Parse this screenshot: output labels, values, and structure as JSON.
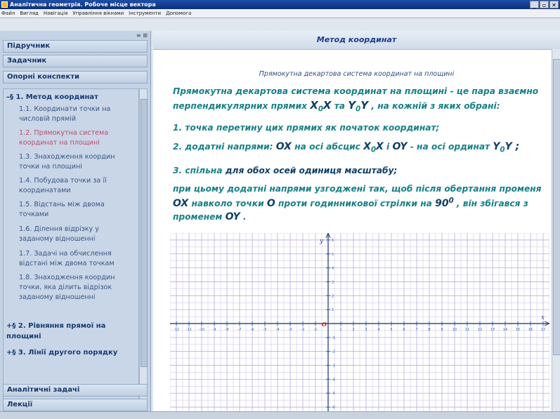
{
  "window": {
    "title": "Аналітична геометрія. Робоче місце вектора",
    "buttons": [
      "_",
      "▫",
      "✕"
    ]
  },
  "menu": [
    "Файл",
    "Вигляд",
    "Навігація",
    "Управління вікнами",
    "Інструменти",
    "Допомога"
  ],
  "sidebar": {
    "pin": "≡ ⊠",
    "tabs": [
      "Підручник",
      "Задачник",
      "Опорні конспекти"
    ],
    "bottom_tabs": [
      "Аналітичні задачі",
      "Лекції"
    ],
    "tree": {
      "sections": [
        {
          "marker": "–",
          "label": "§ 1. Метод координат",
          "items": [
            {
              "lines": [
                "1.1. Координати точки на",
                "числовій прямій"
              ]
            },
            {
              "lines": [
                "1.2. Прямокутна система",
                "координат на площині"
              ],
              "active": true
            },
            {
              "lines": [
                "1.3. Знаходження координ",
                "точки на площині"
              ]
            },
            {
              "lines": [
                "1.4. Побудова точки за її",
                "координатами"
              ]
            },
            {
              "lines": [
                "1.5. Відстань між двома",
                "точками"
              ]
            },
            {
              "lines": [
                "1.6. Ділення відрізку у",
                "заданому відношенні"
              ]
            },
            {
              "lines": [
                "1.7. Задачі на обчислення",
                "відстані між двома точкам"
              ]
            },
            {
              "lines": [
                "1.8. Знаходження координ",
                "точки, яка ділить відрізок",
                "заданому відношенні"
              ]
            }
          ]
        },
        {
          "marker": "+",
          "lines": [
            "§ 2. Рівняння прямої на",
            "площині"
          ]
        },
        {
          "marker": "+",
          "lines": [
            "§ 3. Лінії другого порядку"
          ]
        }
      ]
    }
  },
  "content": {
    "title": "Метод координат",
    "subtitle": "Прямокутна декартова система координат на площині",
    "p1": {
      "l1": "Прямокутна декартова система координат на площині - це пара взаємно",
      "l2a": "перпендикулярних прямих ",
      "l2b": "X",
      "l2c": "0",
      "l2d": "X",
      "l2e": " та ",
      "l2f": "Y",
      "l2g": "0",
      "l2h": "Y",
      "l2i": " , на кожній з яких обрані:"
    },
    "item1": "1. точка перетину цих прямих як початок координат;",
    "item2": {
      "a": "2. додатні напрями: ",
      "b": "OX",
      "c": " на осі абсцис ",
      "d": "X",
      "e": "0",
      "f": "X",
      "g": " і ",
      "h": "OY",
      "i": " - на осі ординат ",
      "j": "Y",
      "k": "0",
      "l": "Y ;"
    },
    "item3": {
      "a": "3. спільна ",
      "b": "для обох осей одиниця масштабу;"
    },
    "p2": {
      "l1": "при цьому додатні напрями узгоджені так, щоб після обертання променя",
      "l2a": "OX",
      "l2b": " навколо точки ",
      "l2c": "O",
      "l2d": " проти годинникової стрілки на ",
      "l2e": "90",
      "l2f": "0",
      "l2g": " , він збігався з",
      "l3a": "променем ",
      "l3b": "OY",
      "l3c": " ."
    }
  },
  "chart_data": {
    "type": "coordinate-grid",
    "x_ticks": [
      -12,
      -11,
      -10,
      -9,
      -8,
      -7,
      -6,
      -5,
      -4,
      -3,
      -2,
      -1,
      1,
      2,
      3,
      4,
      5,
      6,
      7,
      8,
      9,
      10,
      11,
      12,
      13,
      14,
      15,
      16,
      17
    ],
    "y_ticks": [
      -6,
      -5,
      -4,
      -3,
      -2,
      -1,
      1,
      2,
      3,
      4,
      5,
      6
    ],
    "axis_labels": {
      "x": "x",
      "y": "y",
      "origin": "O"
    },
    "xlim": [
      -12.5,
      17.5
    ],
    "ylim": [
      -6.5,
      6.5
    ],
    "grid": true,
    "colors": {
      "axis": "#3c4a8a",
      "grid": "#b7aee0",
      "tick": "#2f63b7",
      "origin": "#c02020"
    }
  }
}
